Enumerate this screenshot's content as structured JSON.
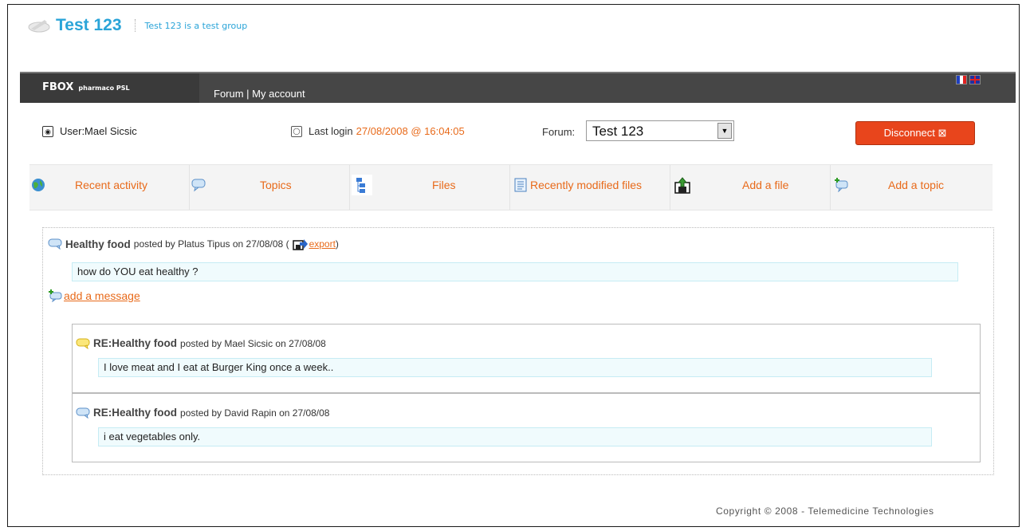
{
  "group": {
    "title": "Test 123",
    "description": "Test 123 is a test group"
  },
  "topbar": {
    "brand": "FBOX",
    "brand_sub": "pharmaco PSL",
    "nav": "Forum | My account"
  },
  "info": {
    "user_label": "User:Mael Sicsic",
    "last_login_label": "Last login",
    "last_login_date": "27/08/2008 @ 16:04:05",
    "forum_label": "Forum:",
    "forum_value": "Test 123",
    "disconnect_label": "Disconnect"
  },
  "menu": [
    {
      "label": "Recent activity",
      "icon": "globe-icon"
    },
    {
      "label": "Topics",
      "icon": "speech-bubble-icon"
    },
    {
      "label": "Files",
      "icon": "files-tree-icon"
    },
    {
      "label": "Recently modified files",
      "icon": "document-icon"
    },
    {
      "label": "Add a file",
      "icon": "upload-file-icon"
    },
    {
      "label": "Add a topic",
      "icon": "add-topic-icon"
    }
  ],
  "topic": {
    "title": "Healthy food",
    "meta": "posted by Platus Tipus on 27/08/08 (",
    "export_label": "export",
    "meta_end": ")",
    "message": "how do YOU eat healthy ?",
    "add_message_label": "add a message"
  },
  "replies": [
    {
      "title": "RE:Healthy food",
      "meta": "posted by Mael Sicsic on 27/08/08",
      "message": "I love meat and I eat at Burger King once a week.."
    },
    {
      "title": "RE:Healthy food",
      "meta": "posted by David Rapin on 27/08/08",
      "message": "i eat vegetables only."
    }
  ],
  "footer": "Copyright © 2008 - Telemedicine Technologies",
  "colors": {
    "accent": "#e86a1a",
    "title_blue": "#2aa4d8",
    "topbar": "#464646",
    "disconnect": "#e8451c"
  }
}
